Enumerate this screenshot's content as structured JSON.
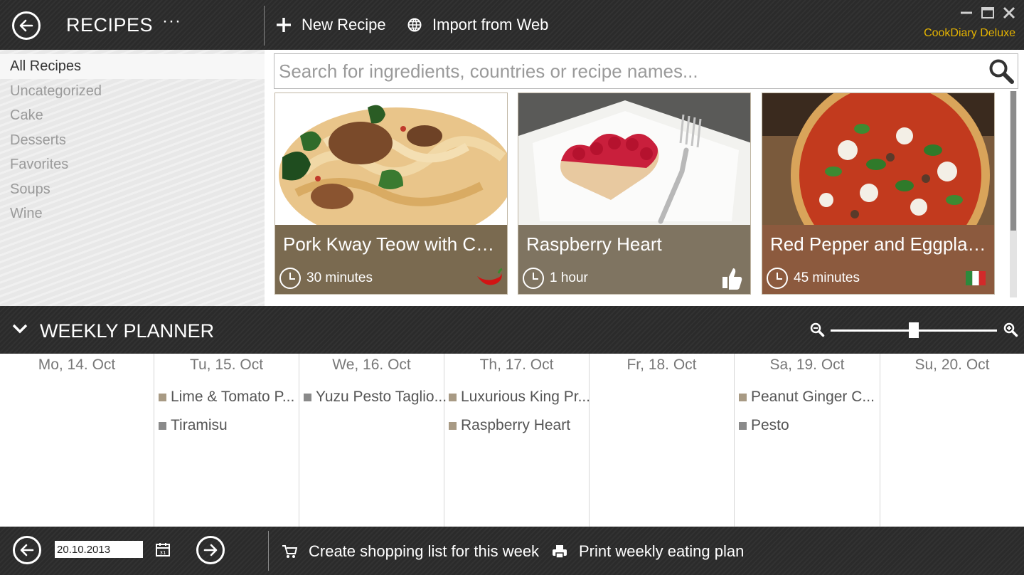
{
  "topbar": {
    "title": "RECIPES",
    "more": "···",
    "new_recipe": "New Recipe",
    "import_web": "Import from Web",
    "brand": "CookDiary Deluxe",
    "brand_color": "#e6b400"
  },
  "sidebar": {
    "categories": [
      "All Recipes",
      "Uncategorized",
      "Cake",
      "Desserts",
      "Favorites",
      "Soups",
      "Wine"
    ],
    "selected": "All Recipes"
  },
  "search": {
    "placeholder": "Search for ingredients, countries or recipe names...",
    "value": ""
  },
  "recipes": [
    {
      "name": "Pork Kway Teow with Chilli...",
      "time": "30 minutes",
      "badge": "chili-icon",
      "info_color": "#7a6a50"
    },
    {
      "name": "Raspberry Heart",
      "time": "1 hour",
      "badge": "thumbs-up-icon",
      "info_color": "#7f7461"
    },
    {
      "name": "Red Pepper and Eggplant...",
      "time": "45 minutes",
      "badge": "italy-flag-icon",
      "info_color": "#8c5a3e"
    }
  ],
  "scrollbar": {
    "position_percent": 0
  },
  "planner": {
    "title": "WEEKLY PLANNER",
    "zoom_level_percent": 50,
    "days": [
      {
        "label": "Mo, 14. Oct",
        "meals": []
      },
      {
        "label": "Tu, 15. Oct",
        "meals": [
          "Lime & Tomato P...",
          "Tiramisu"
        ]
      },
      {
        "label": "We, 16. Oct",
        "meals": [
          "Yuzu Pesto Taglio..."
        ]
      },
      {
        "label": "Th, 17. Oct",
        "meals": [
          "Luxurious King Pr...",
          "Raspberry Heart"
        ]
      },
      {
        "label": "Fr, 18. Oct",
        "meals": []
      },
      {
        "label": "Sa, 19. Oct",
        "meals": [
          "Peanut Ginger C...",
          "Pesto"
        ]
      },
      {
        "label": "Su, 20. Oct",
        "meals": []
      }
    ],
    "meal_colors": [
      "#a89a84",
      "#8a8a8a"
    ]
  },
  "bottombar": {
    "date_value": "20.10.2013",
    "shopping_list": "Create shopping list for this week",
    "print_plan": "Print weekly eating plan"
  }
}
